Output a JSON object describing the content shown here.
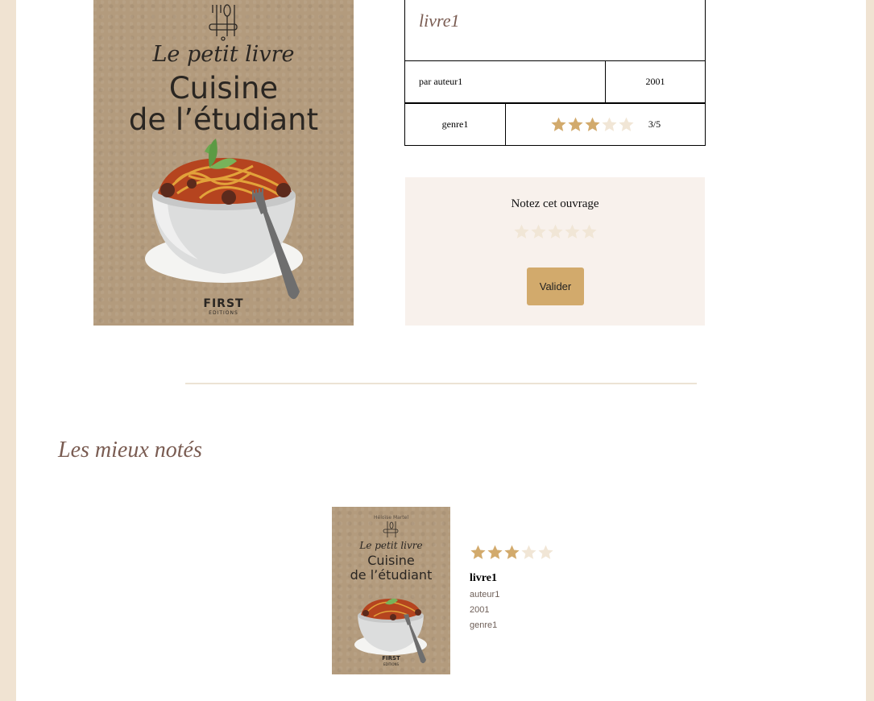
{
  "book": {
    "title": "livre1",
    "author_label": "par auteur1",
    "year": "2001",
    "genre": "genre1",
    "rating": 3,
    "rating_max": 5,
    "rating_label": "3/5",
    "cover": {
      "script_title": "Le petit livre",
      "title_line1": "Cuisine",
      "title_line2": "de l’étudiant",
      "publisher": "FIRST",
      "publisher_sub": "EDITIONS"
    }
  },
  "rate_form": {
    "prompt": "Notez cet ouvrage",
    "current_rating": 0,
    "submit_label": "Valider"
  },
  "top_rated": {
    "heading": "Les mieux notés",
    "items": [
      {
        "cover_author": "Héloïse Martel",
        "cover_script": "Le petit livre",
        "cover_line1": "Cuisine",
        "cover_line2": "de l’étudiant",
        "cover_publisher": "FIRST",
        "cover_publisher_sub": "EDITIONS",
        "rating": 3,
        "title": "livre1",
        "author": "auteur1",
        "year": "2001",
        "genre": "genre1"
      }
    ]
  },
  "colors": {
    "star_filled": "#d2aa6c",
    "star_empty": "#f1e6d6",
    "heading": "#7a5c52",
    "button": "#d2aa6c",
    "panel": "#f8f1ec",
    "side_background": "#f0e3d2"
  },
  "icons": [
    "star-icon",
    "fork-icon"
  ]
}
